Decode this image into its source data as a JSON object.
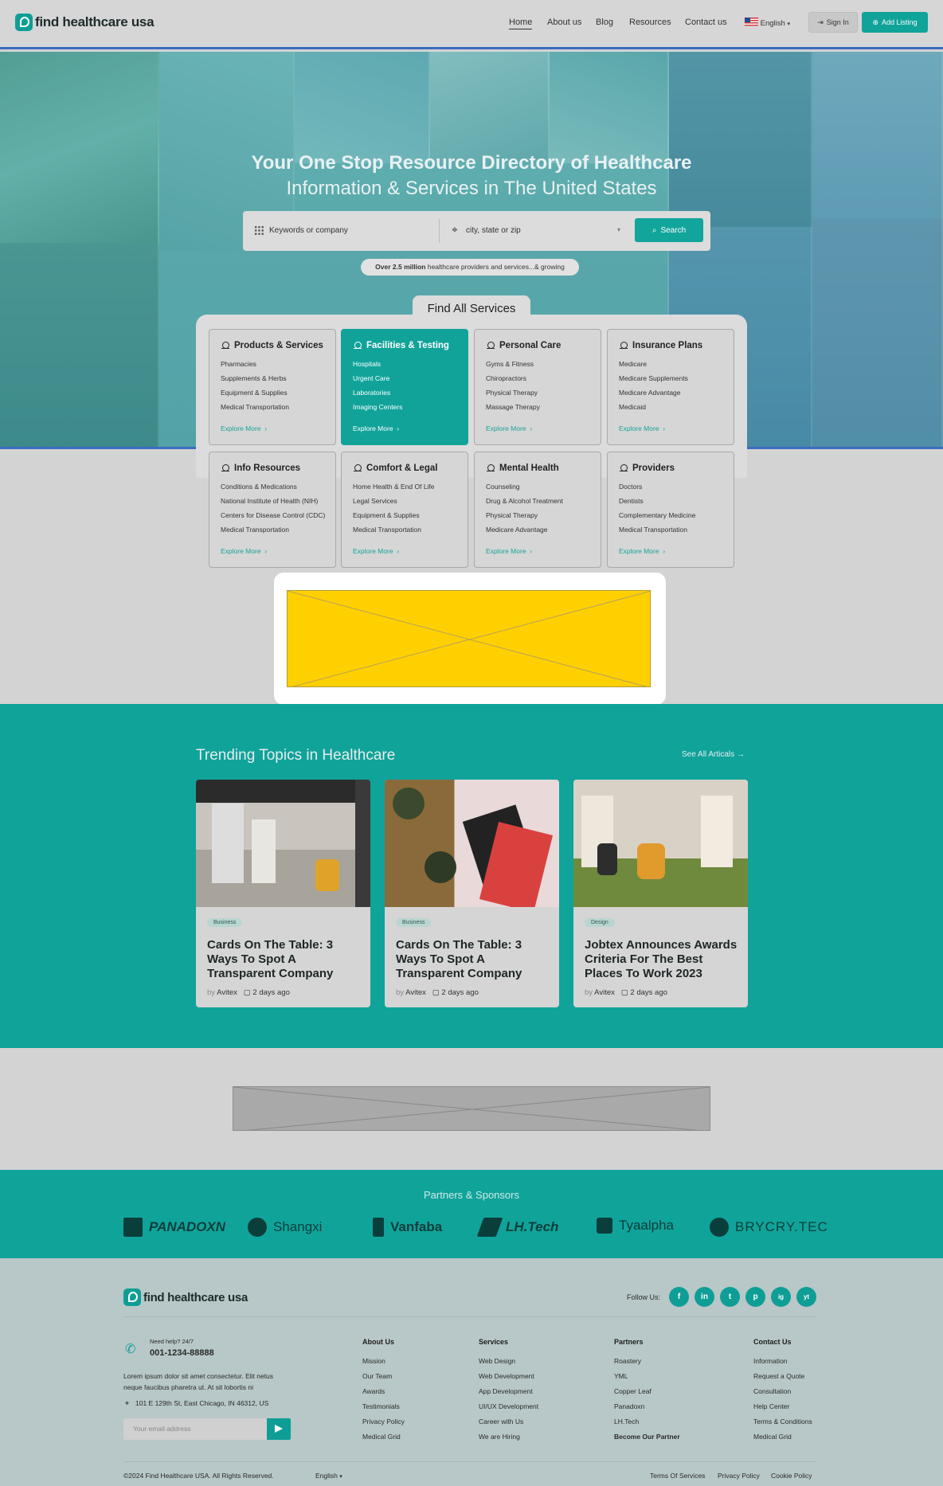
{
  "header": {
    "logo_text": "find healthcare usa",
    "nav": [
      "Home",
      "About us",
      "Blog",
      "Resources",
      "Contact us"
    ],
    "language": "English",
    "sign_in": "Sign In",
    "add_listing": "Add Listing"
  },
  "hero": {
    "title_line1": "Your One Stop Resource Directory of Healthcare",
    "title_line2": "Information & Services in The United States",
    "keywords_placeholder": "Keywords or company",
    "location_placeholder": "city, state or zip",
    "search_button": "Search",
    "stat_bold": "Over 2.5 million",
    "stat_text": " healthcare providers and services...& growing",
    "find_all_services": "Find All Services"
  },
  "categories": [
    {
      "title": "Products & Services",
      "items": [
        "Pharmacies",
        "Supplements & Herbs",
        "Equipment & Supplies",
        "Medical Transportation"
      ],
      "link": "Explore More",
      "highlighted": false
    },
    {
      "title": "Facilities & Testing",
      "items": [
        "Hospitals",
        "Urgent Care",
        "Laboratories",
        "Imaging Centers"
      ],
      "link": "Explore More",
      "highlighted": true
    },
    {
      "title": "Personal Care",
      "items": [
        "Gyms & Fitness",
        "Chiropractors",
        "Physical Therapy",
        "Massage Therapy"
      ],
      "link": "Explore More",
      "highlighted": false
    },
    {
      "title": "Insurance Plans",
      "items": [
        "Medicare",
        "Medicare Supplements",
        "Medicare Advantage",
        "Medicaid"
      ],
      "link": "Explore More",
      "highlighted": false
    },
    {
      "title": "Info Resources",
      "items": [
        "Conditions & Medications",
        "National Institute of Health (NIH)",
        "Centers for Disease Control (CDC)",
        "Medical Transportation"
      ],
      "link": "Explore More",
      "highlighted": false
    },
    {
      "title": "Comfort & Legal",
      "items": [
        "Home Health & End Of Life",
        "Legal Services",
        "Equipment & Supplies",
        "Medical Transportation"
      ],
      "link": "Explore More",
      "highlighted": false
    },
    {
      "title": "Mental Health",
      "items": [
        "Counseling",
        "Drug & Alcohol Treatment",
        "Physical Therapy",
        "Medicare Advantage"
      ],
      "link": "Explore More",
      "highlighted": false
    },
    {
      "title": "Providers",
      "items": [
        "Doctors",
        "Dentists",
        "Complementary Medicine",
        "Medical Transportation"
      ],
      "link": "Explore More",
      "highlighted": false
    }
  ],
  "trending": {
    "title": "Trending Topics in Healthcare",
    "see_all": "See All Articals",
    "posts": [
      {
        "tag": "Business",
        "title": "Cards On The Table: 3 Ways To Spot A Transparent Company",
        "by": "by",
        "author": "Avitex",
        "date": "2 days ago"
      },
      {
        "tag": "Business",
        "title": "Cards On The Table: 3 Ways To Spot A Transparent Company",
        "by": "by",
        "author": "Avitex",
        "date": "2 days ago"
      },
      {
        "tag": "Design",
        "title": "Jobtex Announces Awards Criteria For The Best Places To Work 2023",
        "by": "by",
        "author": "Avitex",
        "date": "2 days ago"
      }
    ]
  },
  "partners": {
    "title": "Partners & Sponsors",
    "logos": [
      "PANADOXN",
      "Shangxi",
      "Vanfaba",
      "LH.Tech",
      "Tyaalpha",
      "BRYCRY.TEC"
    ]
  },
  "footer": {
    "logo_text": "find healthcare usa",
    "follow_us": "Follow Us:",
    "social": [
      "f",
      "in",
      "t",
      "p",
      "ig",
      "yt"
    ],
    "need_help": "Need help? 24/7",
    "phone": "001-1234-88888",
    "about": "Lorem ipsum dolor sit amet consectetur. Elit netus neque faucibus pharetra ut. At sit lobortis ni",
    "address": "101 E 129th St, East Chicago, IN 46312, US",
    "email_placeholder": "Your email address",
    "columns": [
      {
        "title": "About Us",
        "links": [
          "Mission",
          "Our Team",
          "Awards",
          "Testimonials",
          "Privacy Policy",
          "Medical Grid"
        ]
      },
      {
        "title": "Services",
        "links": [
          "Web Design",
          "Web Development",
          "App Development",
          "UI/UX Development",
          "Career with Us",
          "We are Hiring"
        ]
      },
      {
        "title": "Partners",
        "links": [
          "Roastery",
          "YML",
          "Copper Leaf",
          "Panadoxn",
          "LH.Tech",
          "Become Our Partner"
        ]
      },
      {
        "title": "Contact Us",
        "links": [
          "Information",
          "Request a Quote",
          "Consultation",
          "Help Center",
          "Terms & Conditions",
          "Medical Grid"
        ]
      }
    ],
    "copyright": "©2024 Find Healthcare USA. All Rights Reserved.",
    "language": "English",
    "bottom_links": [
      "Terms Of Services",
      "Privacy Policy",
      "Cookie Policy"
    ]
  },
  "colors": {
    "accent": "#10a39a",
    "hero_border": "#3b6cc0",
    "ad_yellow": "#ffd000"
  }
}
